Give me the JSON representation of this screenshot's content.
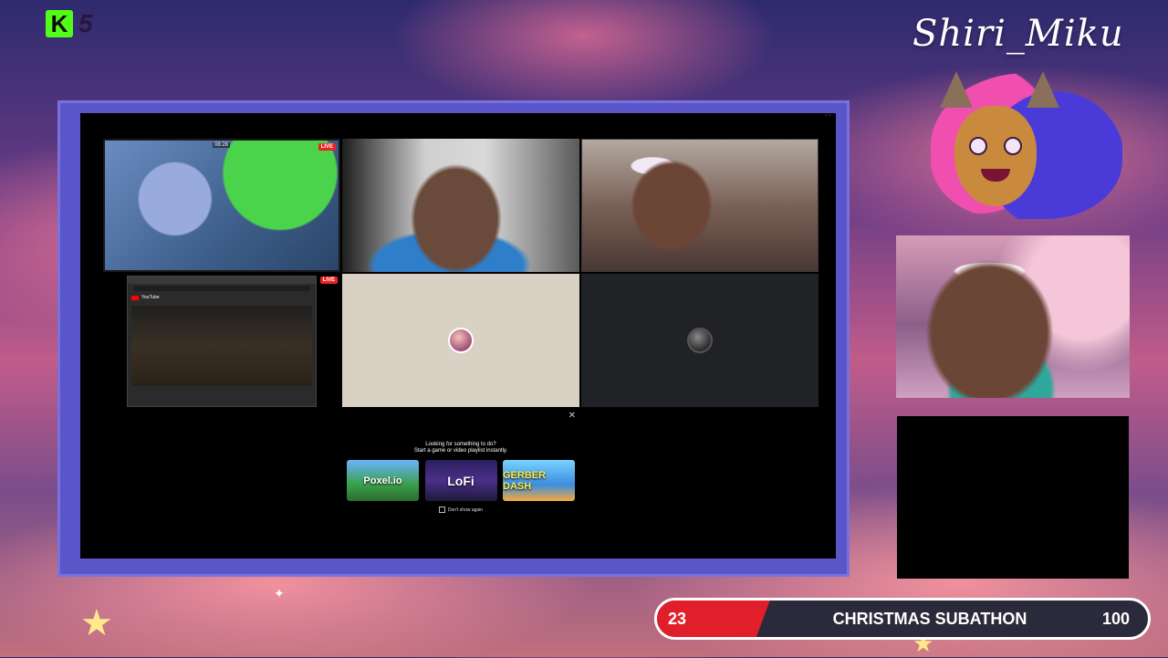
{
  "brand": {
    "logo_letter": "K",
    "logo_count": "5"
  },
  "streamer": {
    "name": "Shiri_Miku"
  },
  "call_grid": {
    "live_badge": "LIVE",
    "game_timer": "08:28",
    "browser": {
      "site": "YouTube"
    },
    "suggestions": {
      "close": "✕",
      "title_line1": "Looking for something to do?",
      "title_line2": "Start a game or video playlist instantly.",
      "cards": [
        "Poxel.io",
        "LoFi",
        "GERBER DASH"
      ],
      "dont_show": "Don't show again"
    }
  },
  "subathon": {
    "current": "23",
    "title": "CHRISTMAS SUBATHON",
    "goal": "100",
    "progress_fraction": 0.23,
    "fill_color": "#e01f2a"
  },
  "icons": [
    "star-icon",
    "close-icon",
    "checkbox-icon"
  ]
}
